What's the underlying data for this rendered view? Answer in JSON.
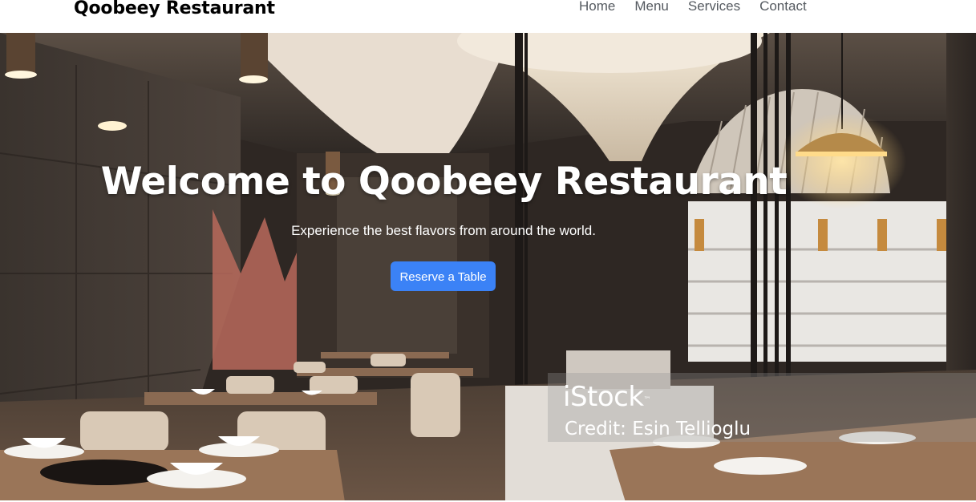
{
  "navbar": {
    "brand": "Qoobeey Restaurant",
    "links": [
      "Home",
      "Menu",
      "Services",
      "Contact"
    ]
  },
  "hero": {
    "title": "Welcome to Qoobeey Restaurant",
    "subtitle": "Experience the best flavors from around the world.",
    "cta_label": "Reserve a Table",
    "cta_color": "#3b82f6",
    "watermark": {
      "logo": "iStock",
      "trademark": "™",
      "credit": "Credit: Esin Tellioglu"
    }
  }
}
